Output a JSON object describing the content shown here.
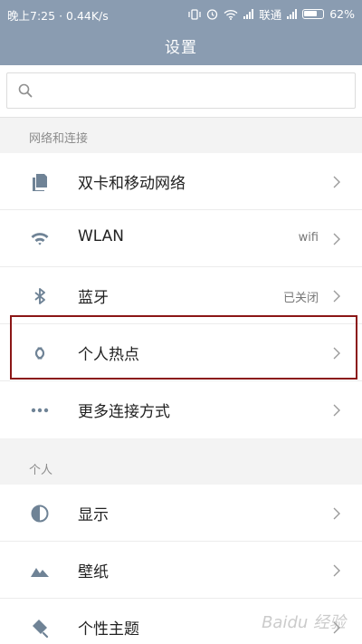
{
  "status_bar": {
    "time": "晚上7:25",
    "speed": "0.44K/s",
    "carrier": "联通",
    "battery": "62%"
  },
  "header": {
    "title": "设置"
  },
  "search": {
    "placeholder": ""
  },
  "sections": [
    {
      "title": "网络和连接",
      "items": [
        {
          "label": "双卡和移动网络",
          "value": "",
          "icon": "sim-card-icon"
        },
        {
          "label": "WLAN",
          "value": "wifi",
          "icon": "wifi-icon"
        },
        {
          "label": "蓝牙",
          "value": "已关闭",
          "icon": "bluetooth-icon"
        },
        {
          "label": "个人热点",
          "value": "",
          "icon": "hotspot-icon"
        },
        {
          "label": "更多连接方式",
          "value": "",
          "icon": "more-dots-icon"
        }
      ]
    },
    {
      "title": "个人",
      "items": [
        {
          "label": "显示",
          "value": "",
          "icon": "display-icon"
        },
        {
          "label": "壁纸",
          "value": "",
          "icon": "wallpaper-icon"
        },
        {
          "label": "个性主题",
          "value": "",
          "icon": "theme-icon"
        }
      ]
    }
  ],
  "watermark": "Baidu 经验",
  "colors": {
    "header_bg": "#8a9cb1",
    "highlight_border": "#8b1616",
    "icon": "#6f8396"
  }
}
